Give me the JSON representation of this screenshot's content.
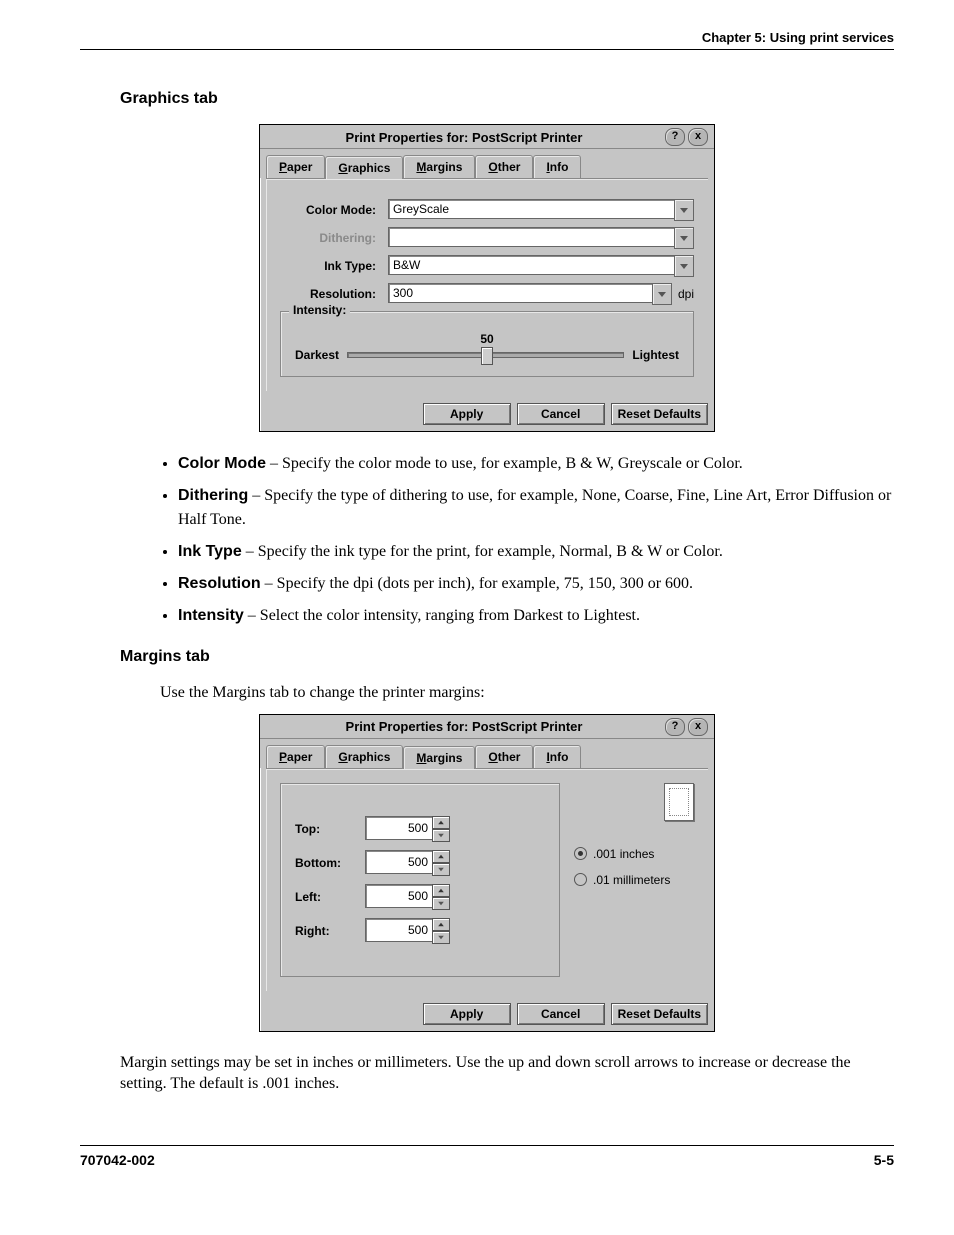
{
  "header": {
    "chapter": "Chapter 5: Using print services"
  },
  "section1": {
    "heading": "Graphics tab"
  },
  "dialog": {
    "title": "Print Properties for: PostScript Printer",
    "help": "?",
    "close": "x",
    "tabs": [
      "Paper",
      "Graphics",
      "Margins",
      "Other",
      "Info"
    ],
    "buttons": {
      "apply": "Apply",
      "cancel": "Cancel",
      "reset": "Reset Defaults"
    }
  },
  "graphics_fields": {
    "color_mode_label": "Color Mode:",
    "color_mode_value": "GreyScale",
    "dithering_label": "Dithering:",
    "dithering_value": "",
    "ink_type_label": "Ink Type:",
    "ink_type_value": "B&W",
    "resolution_label": "Resolution:",
    "resolution_value": "300",
    "resolution_unit": "dpi",
    "intensity_label": "Intensity:",
    "intensity_value": "50",
    "darkest": "Darkest",
    "lightest": "Lightest"
  },
  "graphics_bullets": [
    {
      "term": "Color Mode",
      "desc": " – Specify the color mode to use, for example, B & W, Greyscale or Color."
    },
    {
      "term": "Dithering",
      "desc": " – Specify the type of dithering to use, for example, None, Coarse, Fine, Line Art, Error Diffusion or Half Tone."
    },
    {
      "term": "Ink Type",
      "desc": " – Specify the ink type for the print, for example, Normal, B & W or Color."
    },
    {
      "term": "Resolution",
      "desc": " – Specify the dpi (dots per inch), for example, 75, 150, 300 or 600."
    },
    {
      "term": "Intensity",
      "desc": " – Select the color intensity, ranging from Darkest to Lightest."
    }
  ],
  "section2": {
    "heading": "Margins tab",
    "intro": "Use the Margins tab to change the printer margins:"
  },
  "margins_fields": {
    "top_label": "Top:",
    "top_value": "500",
    "bottom_label": "Bottom:",
    "bottom_value": "500",
    "left_label": "Left:",
    "left_value": "500",
    "right_label": "Right:",
    "right_value": "500",
    "unit_inches": ".001 inches",
    "unit_mm": ".01 millimeters"
  },
  "margins_note": "Margin settings may be set in inches or millimeters. Use the up and down scroll arrows to increase or decrease the setting. The default is .001 inches.",
  "footer": {
    "left": "707042-002",
    "right": "5-5"
  },
  "chart_data": {
    "type": "table",
    "title": "Intensity slider",
    "categories": [
      "value"
    ],
    "values": [
      50
    ],
    "xlabel": "Darkest",
    "ylabel": "Lightest",
    "ylim": [
      0,
      100
    ]
  }
}
